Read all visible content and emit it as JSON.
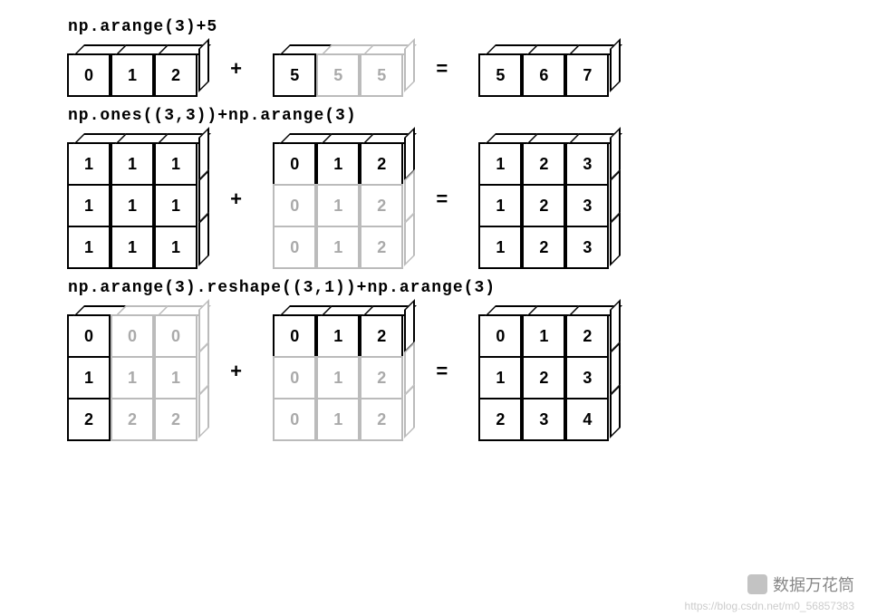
{
  "ex1": {
    "expr": "np.arange(3)+5",
    "left": [
      "0",
      "1",
      "2"
    ],
    "mid_solid": [
      "5"
    ],
    "mid_ghost": [
      "5",
      "5"
    ],
    "right": [
      "5",
      "6",
      "7"
    ],
    "plus": "+",
    "eq": "="
  },
  "ex2": {
    "expr": "np.ones((3,3))+np.arange(3)",
    "left": [
      [
        "1",
        "1",
        "1"
      ],
      [
        "1",
        "1",
        "1"
      ],
      [
        "1",
        "1",
        "1"
      ]
    ],
    "mid_solid": [
      "0",
      "1",
      "2"
    ],
    "mid_ghost": [
      [
        "0",
        "1",
        "2"
      ],
      [
        "0",
        "1",
        "2"
      ]
    ],
    "right": [
      [
        "1",
        "2",
        "3"
      ],
      [
        "1",
        "2",
        "3"
      ],
      [
        "1",
        "2",
        "3"
      ]
    ],
    "plus": "+",
    "eq": "="
  },
  "ex3": {
    "expr": "np.arange(3).reshape((3,1))+np.arange(3)",
    "left_solid": [
      "0",
      "1",
      "2"
    ],
    "left_ghost": [
      [
        "0",
        "0"
      ],
      [
        "1",
        "1"
      ],
      [
        "2",
        "2"
      ]
    ],
    "mid_solid": [
      "0",
      "1",
      "2"
    ],
    "mid_ghost": [
      [
        "0",
        "1",
        "2"
      ],
      [
        "0",
        "1",
        "2"
      ]
    ],
    "right": [
      [
        "0",
        "1",
        "2"
      ],
      [
        "1",
        "2",
        "3"
      ],
      [
        "2",
        "3",
        "4"
      ]
    ],
    "plus": "+",
    "eq": "="
  },
  "watermark": "数据万花筒",
  "watermark_sub": "https://blog.csdn.net/m0_56857383"
}
